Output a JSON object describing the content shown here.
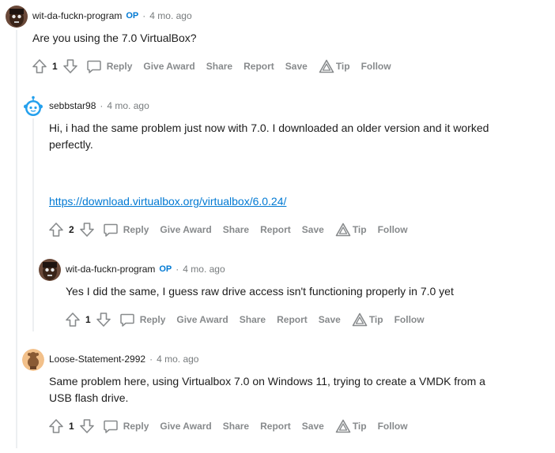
{
  "colors": {
    "op": "#0079d3",
    "link": "#0079d3",
    "meta": "#787c7e",
    "action": "#878a8c"
  },
  "comments": [
    {
      "author": "wit-da-fuckn-program",
      "op_badge": "OP",
      "time": "4 mo. ago",
      "lines": [
        "Are you using the 7.0 VirtualBox?"
      ],
      "score": "1",
      "avatar": "dark-face-avatar"
    },
    {
      "author": "sebbstar98",
      "time": "4 mo. ago",
      "lines": [
        "Hi, i had the same problem just now with 7.0. I downloaded an older version and it worked",
        "perfectly."
      ],
      "link": "https://download.virtualbox.org/virtualbox/6.0.24/",
      "score": "2",
      "avatar": "blue-snoo-avatar"
    },
    {
      "author": "wit-da-fuckn-program",
      "op_badge": "OP",
      "time": "4 mo. ago",
      "lines": [
        "Yes I did the same, I guess raw drive access isn't functioning properly in 7.0 yet"
      ],
      "score": "1",
      "avatar": "dark-face-avatar"
    },
    {
      "author": "Loose-Statement-2992",
      "time": "4 mo. ago",
      "lines": [
        "Same problem here, using Virtualbox 7.0 on Windows 11, trying to create a VMDK from a",
        "USB flash drive."
      ],
      "score": "1",
      "avatar": "orange-snoo-avatar"
    }
  ],
  "actions": {
    "reply": "Reply",
    "give_award": "Give Award",
    "share": "Share",
    "report": "Report",
    "save": "Save",
    "tip": "Tip",
    "follow": "Follow"
  },
  "meta_separator": "·"
}
